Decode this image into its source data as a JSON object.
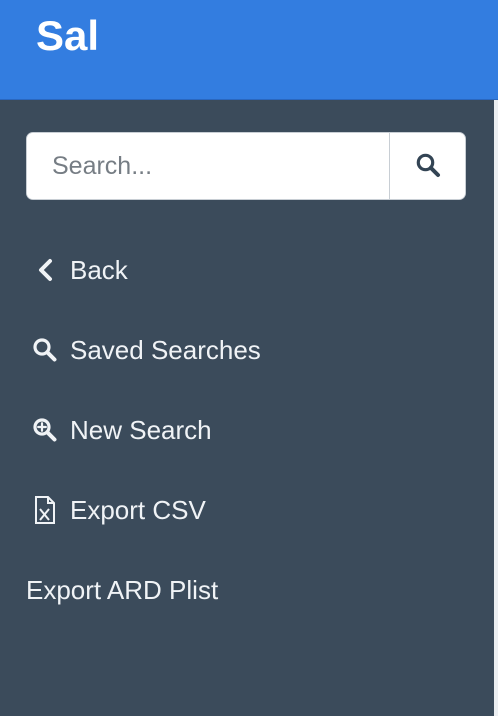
{
  "header": {
    "brand": "Sal",
    "brand_color": "#337de0"
  },
  "search": {
    "placeholder": "Search...",
    "value": "",
    "button_icon": "search-icon"
  },
  "sidebar": {
    "background": "#3b4b5b",
    "items": [
      {
        "id": "back",
        "label": "Back",
        "icon": "chevron-left-icon"
      },
      {
        "id": "saved-searches",
        "label": "Saved Searches",
        "icon": "search-icon"
      },
      {
        "id": "new-search",
        "label": "New Search",
        "icon": "zoom-in-icon"
      },
      {
        "id": "export-csv",
        "label": "Export CSV",
        "icon": "file-excel-icon"
      },
      {
        "id": "export-ard-plist",
        "label": "Export ARD Plist",
        "icon": ""
      }
    ]
  }
}
